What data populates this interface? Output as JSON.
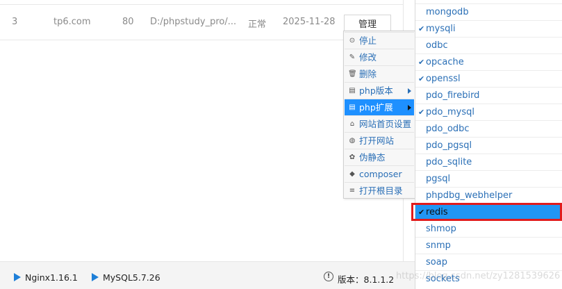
{
  "site_row": {
    "id": "3",
    "domain": "tp6.com",
    "port": "80",
    "path": "D:/phpstudy_pro/...",
    "status": "正常",
    "date": "2025-11-28",
    "manage_label": "管理"
  },
  "context_menu": {
    "items": [
      {
        "label": "停止",
        "icon": "stop-icon",
        "glyph": "⊙"
      },
      {
        "label": "修改",
        "icon": "edit-icon",
        "glyph": "✎"
      },
      {
        "label": "删除",
        "icon": "trash-icon",
        "glyph": "🗑"
      },
      {
        "label": "php版本",
        "icon": "php-version-icon",
        "glyph": "▤"
      },
      {
        "label": "php扩展",
        "icon": "php-extension-icon",
        "glyph": "▤"
      },
      {
        "label": "网站首页设置",
        "icon": "home-icon",
        "glyph": "⌂"
      },
      {
        "label": "打开网站",
        "icon": "globe-icon",
        "glyph": "◍"
      },
      {
        "label": "伪静态",
        "icon": "gear-icon",
        "glyph": "✿"
      },
      {
        "label": "composer",
        "icon": "composer-icon",
        "glyph": "◆"
      },
      {
        "label": "打开根目录",
        "icon": "list-icon",
        "glyph": "≡"
      }
    ]
  },
  "extensions": {
    "items": [
      {
        "label": "mongodb",
        "checked": false
      },
      {
        "label": "mysqli",
        "checked": true
      },
      {
        "label": "odbc",
        "checked": false
      },
      {
        "label": "opcache",
        "checked": true
      },
      {
        "label": "openssl",
        "checked": true
      },
      {
        "label": "pdo_firebird",
        "checked": false
      },
      {
        "label": "pdo_mysql",
        "checked": true
      },
      {
        "label": "pdo_odbc",
        "checked": false
      },
      {
        "label": "pdo_pgsql",
        "checked": false
      },
      {
        "label": "pdo_sqlite",
        "checked": false
      },
      {
        "label": "pgsql",
        "checked": false
      },
      {
        "label": "phpdbg_webhelper",
        "checked": false
      },
      {
        "label": "redis",
        "checked": true
      },
      {
        "label": "shmop",
        "checked": false
      },
      {
        "label": "snmp",
        "checked": false
      },
      {
        "label": "soap",
        "checked": false
      },
      {
        "label": "sockets",
        "checked": false
      }
    ],
    "check_glyph": "✔"
  },
  "status_bar": {
    "nginx": "Nginx1.16.1",
    "mysql": "MySQL5.7.26",
    "version": "版本：8.1.1.2"
  },
  "watermark": "https://blog.csdn.net/zy1281539626",
  "colors": {
    "accent": "#1e90ff",
    "link": "#2a6fb6",
    "highlight": "#e21b1b"
  }
}
